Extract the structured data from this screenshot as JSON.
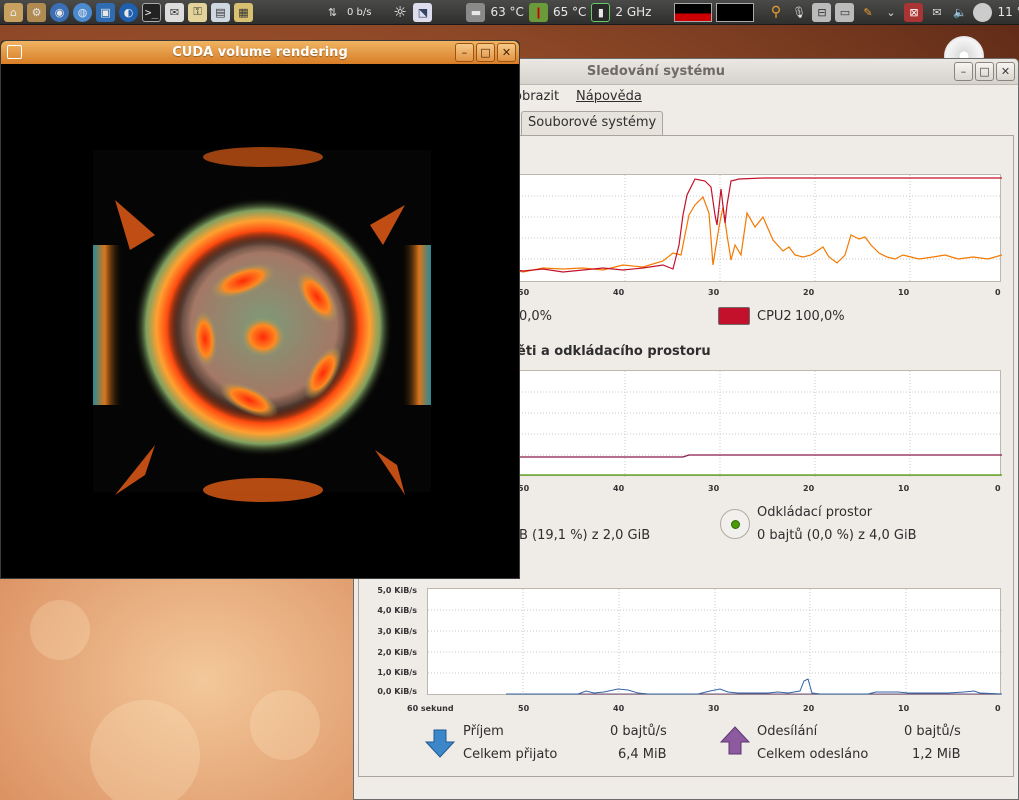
{
  "panel": {
    "net_speed": "0 b/s",
    "temp1": "63 °C",
    "temp2": "65 °C",
    "cpu_freq": "2 GHz",
    "clock_partial": "11 °"
  },
  "sysmon": {
    "title": "Sledování systému",
    "menu": {
      "view": "obrazit",
      "help": "Nápověda"
    },
    "tab_filesystems": "Souborové systémy",
    "cpu": {
      "cpu1_value": "0,0%",
      "cpu2_label": "CPU2",
      "cpu2_value": "100,0%",
      "cpu1_color": "#f57900",
      "cpu2_color": "#c4112b"
    },
    "memory": {
      "title": "ěti a odkládacího prostoru",
      "mem_value": "B (19,1 %) z 2,0 GiB",
      "swap_label": "Odkládací prostor",
      "swap_value": "0 bajtů (0,0 %) z 4,0 GiB",
      "mem_color": "#8a1a4a",
      "swap_color": "#4e9a06"
    },
    "network": {
      "y_ticks": [
        "5,0 KiB/s",
        "4,0 KiB/s",
        "3,0 KiB/s",
        "2,0 KiB/s",
        "1,0 KiB/s",
        "0,0 KiB/s"
      ],
      "recv_label": "Příjem",
      "recv_rate": "0 bajtů/s",
      "recv_total_label": "Celkem přijato",
      "recv_total": "6,4 MiB",
      "send_label": "Odesílání",
      "send_rate": "0 bajtů/s",
      "send_total_label": "Celkem odesláno",
      "send_total": "1,2 MiB",
      "recv_color": "#3465a4",
      "send_color": "#75507b"
    },
    "x_ticks": [
      "50",
      "40",
      "30",
      "20",
      "10",
      "0"
    ],
    "x_first_label": "60 sekund"
  },
  "cuda": {
    "title": "CUDA volume rendering"
  }
}
